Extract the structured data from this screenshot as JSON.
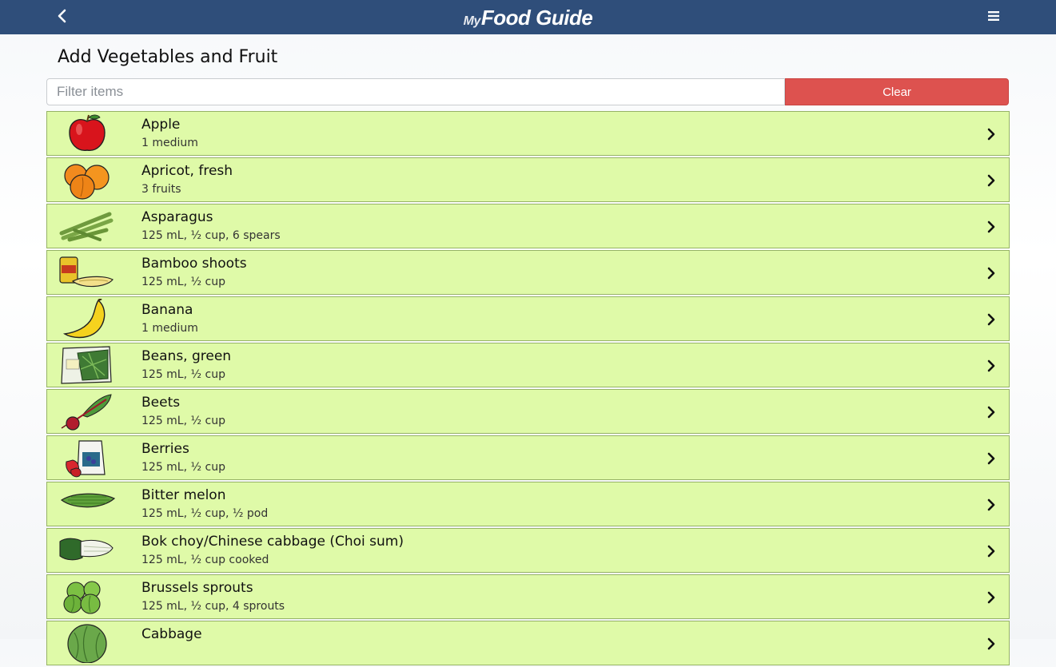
{
  "app": {
    "logo_prefix": "My",
    "logo_main": "Food Guide"
  },
  "header": {
    "back_icon": "chevron-left-icon",
    "menu_icon": "hamburger-menu-icon"
  },
  "page": {
    "title": "Add Vegetables and Fruit"
  },
  "filter": {
    "placeholder": "Filter items",
    "value": "",
    "clear_label": "Clear"
  },
  "colors": {
    "header_bg": "#2f4e7a",
    "item_bg": "#dffaa8",
    "item_border": "#96b365",
    "clear_bg": "#dd524f"
  },
  "items": [
    {
      "name": "Apple",
      "serving": "1 medium",
      "icon": "apple-icon"
    },
    {
      "name": "Apricot, fresh",
      "serving": "3 fruits",
      "icon": "apricot-icon"
    },
    {
      "name": "Asparagus",
      "serving": "125 mL, ½ cup, 6 spears",
      "icon": "asparagus-icon"
    },
    {
      "name": "Bamboo shoots",
      "serving": "125 mL, ½ cup",
      "icon": "bamboo-shoots-icon"
    },
    {
      "name": "Banana",
      "serving": "1 medium",
      "icon": "banana-icon"
    },
    {
      "name": "Beans, green",
      "serving": "125 mL, ½ cup",
      "icon": "green-beans-icon"
    },
    {
      "name": "Beets",
      "serving": "125 mL, ½ cup",
      "icon": "beets-icon"
    },
    {
      "name": "Berries",
      "serving": "125 mL, ½ cup",
      "icon": "berries-icon"
    },
    {
      "name": "Bitter melon",
      "serving": "125 mL, ½ cup, ½ pod",
      "icon": "bitter-melon-icon"
    },
    {
      "name": "Bok choy/Chinese cabbage (Choi sum)",
      "serving": "125 mL, ½ cup cooked",
      "icon": "bok-choy-icon"
    },
    {
      "name": "Brussels sprouts",
      "serving": "125 mL, ½ cup, 4 sprouts",
      "icon": "brussels-sprouts-icon"
    },
    {
      "name": "Cabbage",
      "serving": "",
      "icon": "cabbage-icon"
    }
  ]
}
